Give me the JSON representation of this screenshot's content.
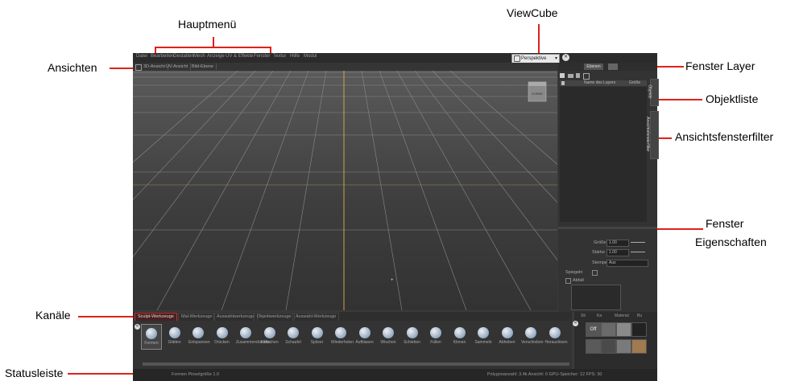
{
  "annotations": {
    "hauptmenue": "Hauptmenü",
    "viewcube": "ViewCube",
    "ansichten": "Ansichten",
    "fenster_layer": "Fenster Layer",
    "objektliste": "Objektliste",
    "ansichtsfensterfilter": "Ansichtsfensterfilter",
    "fenster_eigenschaften_1": "Fenster",
    "fenster_eigenschaften_2": "Eigenschaften",
    "kanaele": "Kanäle",
    "statusleiste": "Statusleiste"
  },
  "menu": [
    "Datei",
    "Bearbeiten",
    "Gestalten",
    "Mesh",
    "Anzeige",
    "UV & Effekte",
    "Fenster",
    "Textur",
    "Hilfe",
    "Modul"
  ],
  "view_tabs": [
    "3D-Ansicht",
    "UV-Ansicht",
    "Bild-Ebene"
  ],
  "viewcube_label": "VORNE",
  "camera_select": "Perspektive",
  "layer_panel": {
    "tab": "Ebenen",
    "col_name": "Name des Layers",
    "col_size": "Größe"
  },
  "side_tabs": [
    "Objekte",
    "Ansichtsfensterfilter"
  ],
  "properties": {
    "size_label": "Größe",
    "size_value": "1.00",
    "strength_label": "Stärke",
    "strength_value": "1.00",
    "stamp_label": "Stempel",
    "stamp_value": "Aus",
    "mirror_label": "Spiegeln",
    "falloff_label": "Abfall"
  },
  "bottom_tabs": [
    "Sculpt-Werkzeuge",
    "Mal-Werkzeuge",
    "Auswahlwerkzeuge",
    "Objektwerkzeuge",
    "Auswahl-Werkzeuge"
  ],
  "tools": [
    "Formen",
    "Glätten",
    "Entspannen",
    "Drücken",
    "Zusammendrücken",
    "Abflachen",
    "Schaufel",
    "Spitzer",
    "Wiederholen",
    "Aufblasen",
    "Wischen",
    "Schieben",
    "Füllen",
    "Klonen",
    "Sammeln",
    "Abheben",
    "Verschieben",
    "Herauslösen"
  ],
  "right_tools": {
    "tabs": [
      "Sti",
      "Ka",
      "Material",
      "Bu"
    ],
    "off_label": "Off"
  },
  "status": {
    "left": "Formen Pinselgröße 1.0",
    "right": "Polygonanzahl: 3.4k Ansicht: 0 GPU-Speicher: 12 FPS: 30"
  }
}
